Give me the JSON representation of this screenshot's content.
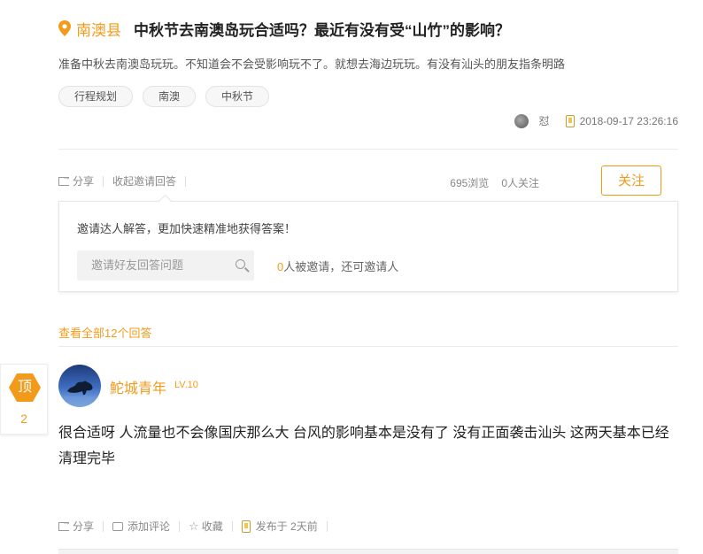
{
  "question": {
    "location": "南澳县",
    "title": "中秋节去南澳岛玩合适吗？最近有没有受“山竹”的影响？",
    "description": "准备中秋去南澳岛玩玩。不知道会不会受影响玩不了。就想去海边玩玩。有没有汕头的朋友指条明路",
    "tags": [
      "行程规划",
      "南澳",
      "中秋节"
    ],
    "author": "怼",
    "datetime": "2018-09-17 23:26:16"
  },
  "actions": {
    "share": "分享",
    "collapse_invite": "收起邀请回答",
    "views": "695浏览",
    "followers": "0人关注",
    "follow_button": "关注"
  },
  "invite": {
    "tip": "邀请达人解答，更加快速精准地获得答案！",
    "placeholder": "邀请好友回答问题",
    "count": "0",
    "count_suffix": "人被邀请，还可邀请人"
  },
  "answers_link": "查看全部12个回答",
  "answer": {
    "vote_label": "顶",
    "vote_count": "2",
    "username": "鮀城青年",
    "level": "LV.10",
    "text": "很合适呀 人流量也不会像国庆那么大 台风的影响基本是没有了 没有正面袭击汕头 这两天基本已经清理完毕",
    "share": "分享",
    "comment": "添加评论",
    "favorite": "收藏",
    "posted": "发布于 2天前"
  },
  "colors": {
    "accent": "#f29b1b"
  }
}
